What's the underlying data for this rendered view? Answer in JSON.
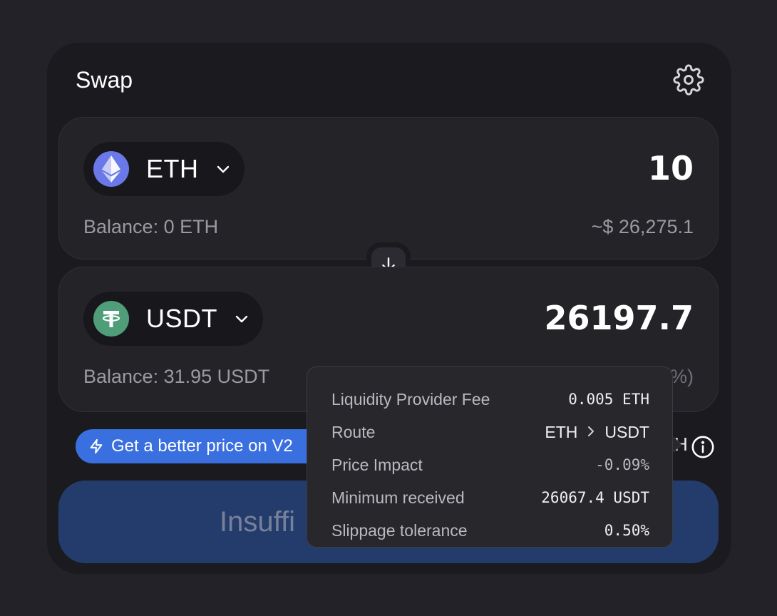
{
  "header": {
    "title": "Swap"
  },
  "from": {
    "token": "ETH",
    "amount": "10",
    "balance": "Balance: 0 ETH",
    "usd": "~$ 26,275.1"
  },
  "to": {
    "token": "USDT",
    "amount": "26197.7",
    "balance": "Balance: 31.95 USDT",
    "usd_fragment": "%)"
  },
  "banner": {
    "label": "Get a better price on V2"
  },
  "rate_fragment": "H",
  "cta": {
    "label": "Insuffi"
  },
  "details": {
    "fee_label": "Liquidity Provider Fee",
    "fee_value": "0.005 ETH",
    "route_label": "Route",
    "route_from": "ETH",
    "route_to": "USDT",
    "impact_label": "Price Impact",
    "impact_value": "-0.09%",
    "min_label": "Minimum received",
    "min_value": "26067.4 USDT",
    "slippage_label": "Slippage tolerance",
    "slippage_value": "0.50%"
  },
  "colors": {
    "background": "#232228",
    "card": "#1b1b1f",
    "accent": "#3a6fe0",
    "eth": "#6a78e8",
    "usdt": "#4f9e79"
  },
  "icons": {
    "settings": "gear-icon",
    "switch": "arrow-down-icon",
    "info": "info-icon",
    "banner": "lightning-icon"
  }
}
